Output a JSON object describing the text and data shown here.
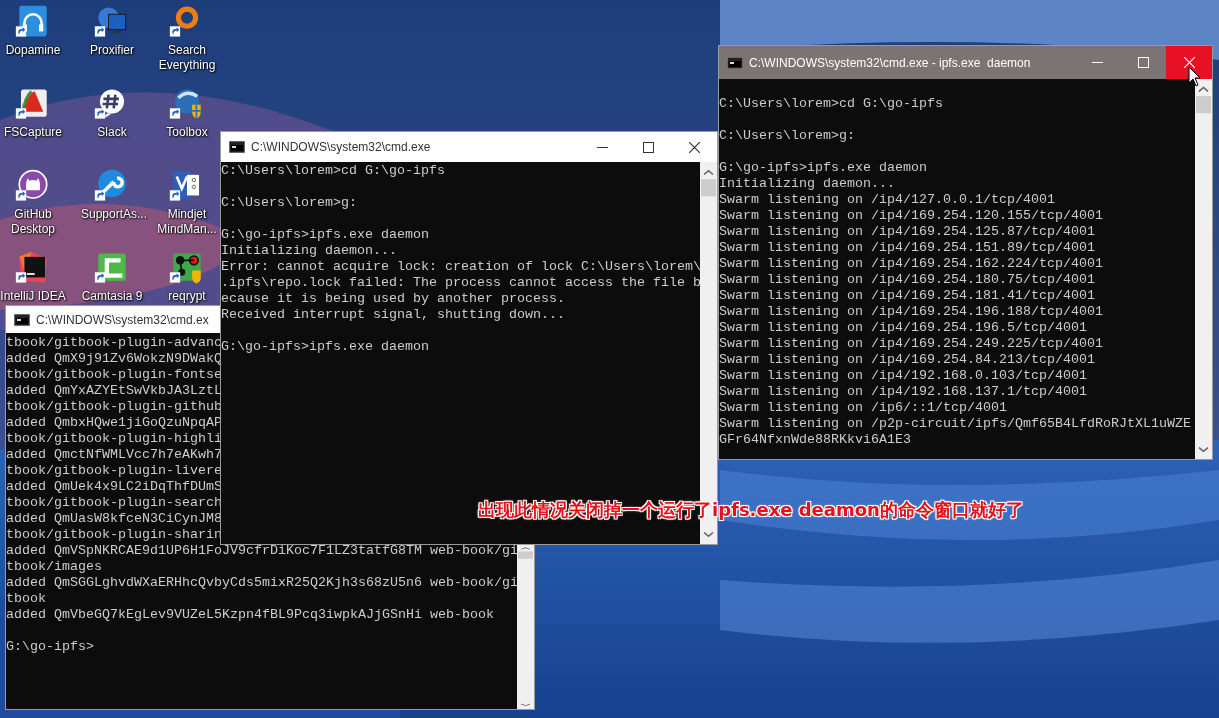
{
  "desktop": {
    "icons": [
      {
        "label": "Dopamine",
        "kind": "headphones"
      },
      {
        "label": "Proxifier",
        "kind": "globe"
      },
      {
        "label": "Search Everything",
        "kind": "ring"
      },
      {
        "label": "FSCapture",
        "kind": "sail"
      },
      {
        "label": "Slack",
        "kind": "chat"
      },
      {
        "label": "Toolbox",
        "kind": "shield"
      },
      {
        "label": "GitHub Desktop",
        "kind": "cat"
      },
      {
        "label": "SupportAs...",
        "kind": "wrench"
      },
      {
        "label": "Mindjet MindMan...",
        "kind": "map"
      },
      {
        "label": "IntelliJ IDEA",
        "kind": "ide"
      },
      {
        "label": "Camtasia 9",
        "kind": "clapper"
      },
      {
        "label": "reqrypt",
        "kind": "nodes"
      }
    ]
  },
  "windows": [
    {
      "title": "C:\\WINDOWS\\system32\\cmd.ex",
      "active": false,
      "blocks": [
        [
          "tbook/gitbook-plugin-advanc",
          "added QmX9j91Zv6WokzN9DWakQ",
          "tbook/gitbook-plugin-fontse",
          "added QmYxAZYEtSwVkbJA3LztL",
          "tbook/gitbook-plugin-github",
          "added QmbxHQwe1jiGoQzuNpqAP",
          "tbook/gitbook-plugin-highli",
          "added QmctNfWMLVcc7h7eAKwh7",
          "tbook/gitbook-plugin-livere",
          "added QmUek4x9LC2iDqThfDUmS",
          "tbook/gitbook-plugin-search",
          "added QmUasW8kfceN3CiCynJM8",
          "tbook/gitbook-plugin-sharin",
          "added QmVSpNKRCAE9d1UP6H1FoJV9cfrDiKoc7F1LZ3tatfG8TM web-book/gi",
          "tbook/images",
          "added QmSGGLghvdWXaERHhcQvbyCds5mixR25Q2Kjh3s68zU5n6 web-book/gi",
          "tbook",
          "added QmVbeGQ7kEgLev9VUZeL5Kzpn4fBL9Pcq3iwpkAJjGSnHi web-book"
        ],
        [
          "G:\\go-ipfs>"
        ]
      ]
    },
    {
      "title": "C:\\WINDOWS\\system32\\cmd.exe",
      "active": false,
      "controls": true,
      "close_hovered": false,
      "blocks": [
        [
          "C:\\Users\\lorem>cd G:\\go-ipfs"
        ],
        [
          "C:\\Users\\lorem>g:"
        ],
        [
          "G:\\go-ipfs>ipfs.exe daemon",
          "Initializing daemon...",
          "Error: cannot acquire lock: creation of lock C:\\Users\\lorem\\",
          ".ipfs\\repo.lock failed: The process cannot access the file b",
          "ecause it is being used by another process.",
          "Received interrupt signal, shutting down..."
        ],
        [
          "G:\\go-ipfs>ipfs.exe daemon"
        ]
      ]
    },
    {
      "title": "C:\\WINDOWS\\system32\\cmd.exe - ipfs.exe  daemon",
      "active": true,
      "controls": true,
      "close_hovered": true,
      "blocks": [
        [
          "C:\\Users\\lorem>cd G:\\go-ipfs"
        ],
        [
          "C:\\Users\\lorem>g:"
        ],
        [
          "G:\\go-ipfs>ipfs.exe daemon",
          "Initializing daemon...",
          "Swarm listening on /ip4/127.0.0.1/tcp/4001",
          "Swarm listening on /ip4/169.254.120.155/tcp/4001",
          "Swarm listening on /ip4/169.254.125.87/tcp/4001",
          "Swarm listening on /ip4/169.254.151.89/tcp/4001",
          "Swarm listening on /ip4/169.254.162.224/tcp/4001",
          "Swarm listening on /ip4/169.254.180.75/tcp/4001",
          "Swarm listening on /ip4/169.254.181.41/tcp/4001",
          "Swarm listening on /ip4/169.254.196.188/tcp/4001",
          "Swarm listening on /ip4/169.254.196.5/tcp/4001",
          "Swarm listening on /ip4/169.254.249.225/tcp/4001",
          "Swarm listening on /ip4/169.254.84.213/tcp/4001",
          "Swarm listening on /ip4/192.168.0.103/tcp/4001",
          "Swarm listening on /ip4/192.168.137.1/tcp/4001",
          "Swarm listening on /ip6/::1/tcp/4001",
          "Swarm listening on /p2p-circuit/ipfs/Qmf65B4LfdRoRJtXL1uWZE",
          "GFr64NfxnWde88RKkvi6A1E3"
        ]
      ]
    }
  ],
  "annotation": "出现此情况关闭掉一个运行了ipfs.exe deamon的命令窗口就好了"
}
